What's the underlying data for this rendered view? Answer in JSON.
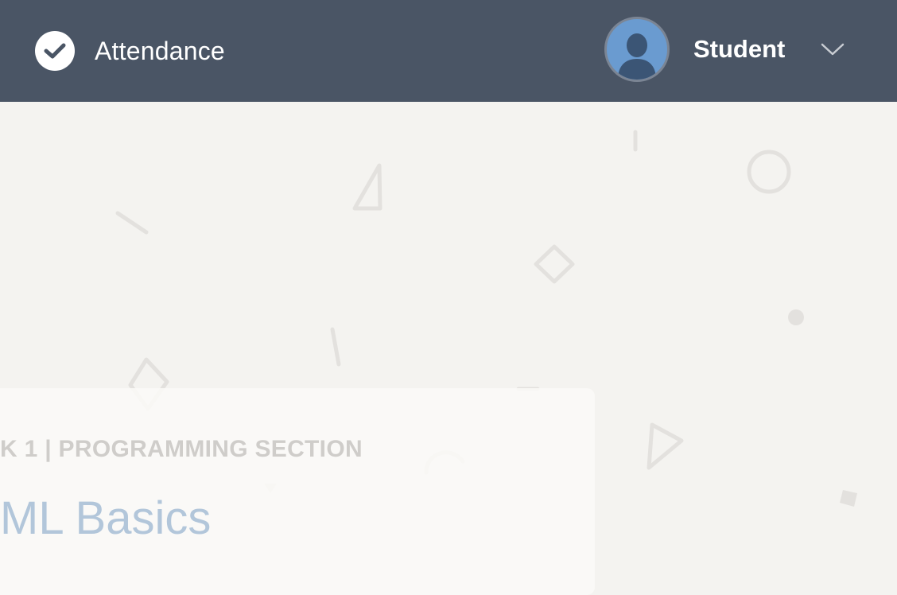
{
  "header": {
    "app_title": "Attendance",
    "logo_icon": "check-circle-icon",
    "user": {
      "name": "Student",
      "avatar_icon": "person-silhouette-icon",
      "menu_icon": "chevron-down-icon"
    }
  },
  "card": {
    "kicker": "K 1 | PROGRAMMING SECTION",
    "title": "ML Basics"
  },
  "colors": {
    "header_bg": "#4a5565",
    "page_bg": "#f4f3f0",
    "avatar_bg": "#6a9bd0",
    "title_color": "#b2c6da",
    "kicker_color": "#cfcdca"
  }
}
